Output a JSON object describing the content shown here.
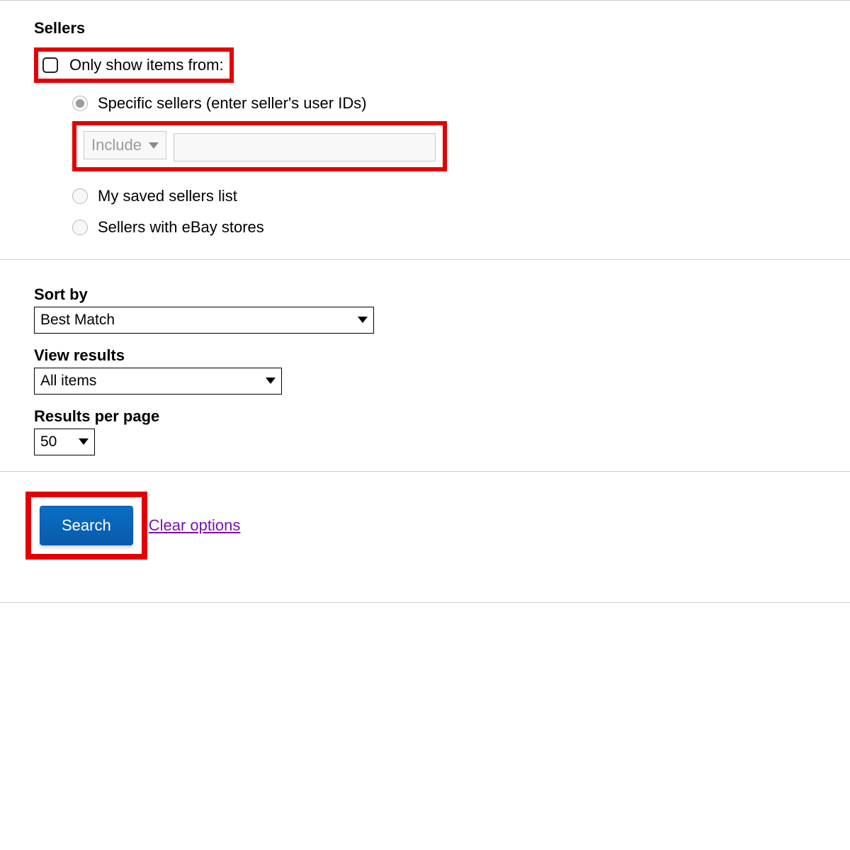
{
  "sellers": {
    "title": "Sellers",
    "only_show": "Only show items from:",
    "radios": {
      "specific": "Specific sellers (enter seller's user IDs)",
      "saved": "My saved sellers list",
      "stores": "Sellers with eBay stores"
    },
    "include_select": "Include"
  },
  "sort": {
    "label": "Sort by",
    "value": "Best Match"
  },
  "view": {
    "label": "View results",
    "value": "All items"
  },
  "results_per_page": {
    "label": "Results per page",
    "value": "50"
  },
  "footer": {
    "search": "Search",
    "clear": "Clear options"
  }
}
